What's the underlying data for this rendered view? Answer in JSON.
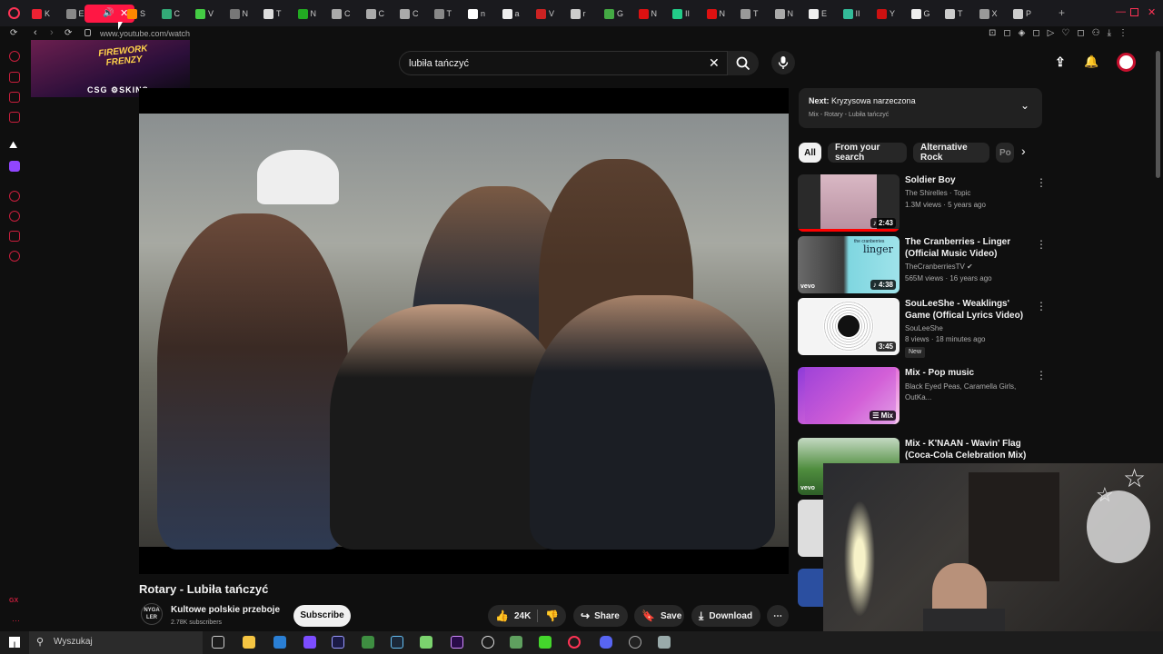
{
  "browser": {
    "url": "www.youtube.com/watch",
    "tabs": [
      "K",
      "E",
      "S",
      "C",
      "V",
      "N",
      "T",
      "N",
      "C",
      "C",
      "C",
      "T",
      "n",
      "a",
      "V",
      "r",
      "G",
      "N",
      "II",
      "N",
      "T",
      "N",
      "E",
      "II",
      "Y",
      "G",
      "T",
      "X",
      "P",
      "F"
    ],
    "colors": {
      "accent": "#ff3355",
      "tab_bg": "#1a1a1e"
    }
  },
  "ad": {
    "title": "FIREWORK FRENZY",
    "brand": "CSG",
    "brand_suffix": "SKINS"
  },
  "search": {
    "query": "lubiła tańczyć"
  },
  "video": {
    "title": "Rotary - Lubiła tańczyć",
    "channel": "Kultowe polskie przeboje",
    "channel_avatar_text": "NYGA LER",
    "subscribers": "2.78K subscribers",
    "subscribe_label": "Subscribe",
    "likes": "24K",
    "share_label": "Share",
    "save_label": "Save",
    "download_label": "Download"
  },
  "next": {
    "label": "Next:",
    "title": "Kryzysowa narzeczona",
    "subtitle": "Mix - Rotary - Lubiła tańczyć"
  },
  "chips": [
    "All",
    "From your search",
    "Alternative Rock",
    "Po"
  ],
  "recommendations": [
    {
      "title": "Soldier Boy",
      "channel": "The Shirelles · Topic",
      "stats": "1.3M views · 5 years ago",
      "duration": "2:43",
      "badge": ""
    },
    {
      "title": "The Cranberries - Linger (Official Music Video)",
      "channel": "TheCranberriesTV",
      "stats": "565M views · 16 years ago",
      "duration": "4:38",
      "badge": "",
      "thumb_text": "linger",
      "thumb_top": "the cranberries",
      "thumb_logo": "vevo"
    },
    {
      "title": "SouLeeShe - Weaklings' Game (Offical Lyrics Video)",
      "channel": "SouLeeShe",
      "stats": "8 views · 18 minutes ago",
      "duration": "3:45",
      "badge": "New"
    },
    {
      "title": "Mix - Pop music",
      "channel": "Black Eyed Peas, Caramella Girls, OutKa...",
      "stats": "",
      "duration": "Mix",
      "badge": ""
    },
    {
      "title": "Mix - K'NAAN - Wavin' Flag (Coca-Cola Celebration Mix)",
      "channel": "",
      "stats": "",
      "duration": "",
      "badge": "",
      "thumb_logo": "vevo"
    }
  ],
  "taskbar": {
    "search_placeholder": "Wyszukaj"
  }
}
